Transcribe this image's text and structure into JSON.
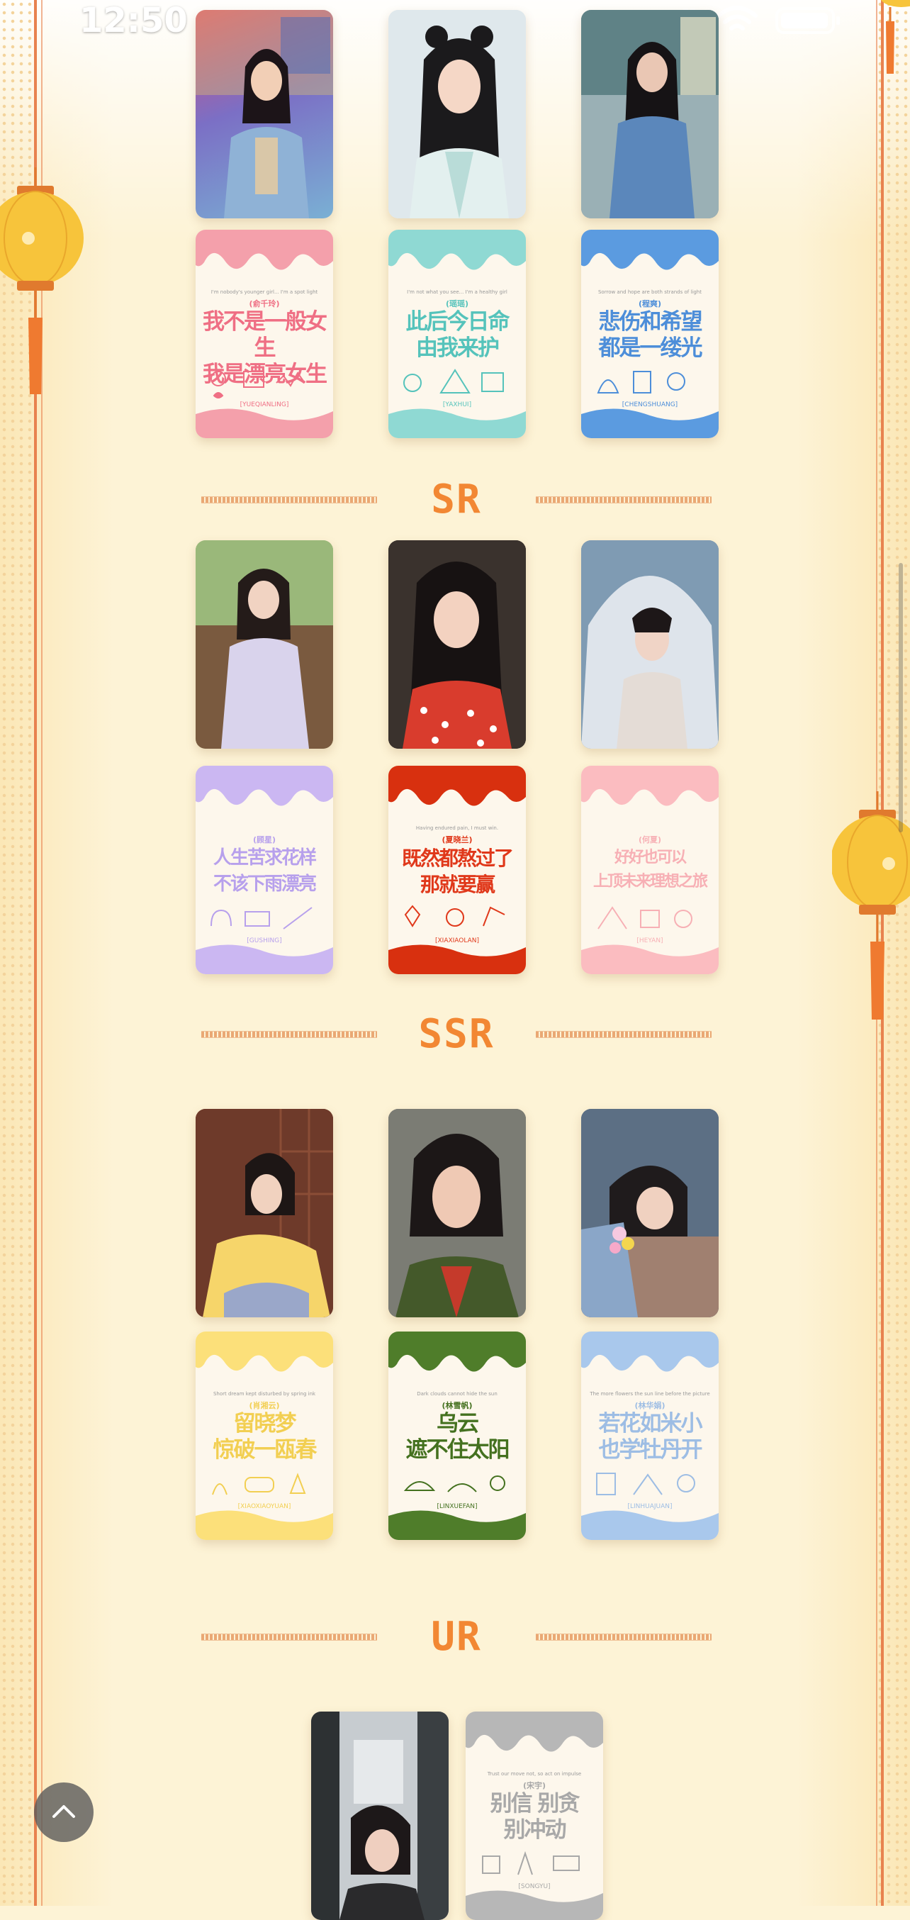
{
  "status_bar": {
    "time": "12:50"
  },
  "sections": [
    {
      "title": "SR"
    },
    {
      "title": "SSR"
    },
    {
      "title": "UR"
    }
  ],
  "text_cards": [
    {
      "en": "I'm nobody's younger girl... I'm a spot light",
      "cn_name": "(俞千玲)",
      "quote_1": "我不是一般女生",
      "quote_2": "我是漂亮女生",
      "pinyin": "[YUEQIANLING]",
      "color": "#f4a0ab",
      "text_color": "#ef6f84"
    },
    {
      "en": "I'm not what you see... I'm a healthy girl",
      "cn_name": "(瑶瑶)",
      "quote_1": "此后今日命",
      "quote_2": "由我来护",
      "pinyin": "[YAXHUI]",
      "color": "#8fd9d3",
      "text_color": "#55c3bb"
    },
    {
      "en": "Sorrow and hope are both strands of light",
      "cn_name": "(程爽)",
      "quote_1": "悲伤和希望",
      "quote_2": "都是一缕光",
      "pinyin": "[CHENGSHUANG]",
      "color": "#5b9be0",
      "text_color": "#4d8ed9"
    },
    {
      "en": "",
      "cn_name": "(顾星)",
      "quote_1": "人生苦求花样",
      "quote_2": "不该下雨漂亮",
      "pinyin": "[GUSHING]",
      "color": "#cbb7f2",
      "text_color": "#b7a0ec"
    },
    {
      "en": "Having endured pain, I must win.",
      "cn_name": "(夏晓兰)",
      "quote_1": "既然都熬过了",
      "quote_2": "那就要赢",
      "pinyin": "[XIAXIAOLAN]",
      "color": "#d8300f",
      "text_color": "#e0381a"
    },
    {
      "en": "",
      "cn_name": "(何夏)",
      "quote_1": "好好也可以",
      "quote_2": "上顶未来理想之旅",
      "pinyin": "[HEYAN]",
      "color": "#fbbcc0",
      "text_color": "#f7b0b5"
    },
    {
      "en": "Short dream kept disturbed by spring ink",
      "cn_name": "(肖湘云)",
      "quote_1": "留晓梦",
      "quote_2": "惊破一瓯春",
      "pinyin": "[XIAOXIAOYUAN]",
      "color": "#fce07a",
      "text_color": "#f2cf52"
    },
    {
      "en": "Dark clouds cannot hide the sun",
      "cn_name": "(林雪帆)",
      "quote_1": "乌云",
      "quote_2": "遮不住太阳",
      "pinyin": "[LINXUEFAN]",
      "color": "#4f7d2a",
      "text_color": "#44711f"
    },
    {
      "en": "The more flowers the sun line before the picture",
      "cn_name": "(林华娟)",
      "quote_1": "若花如米小",
      "quote_2": "也学牡丹开",
      "pinyin": "[LINHUAJUAN]",
      "color": "#a9c8ec",
      "text_color": "#9dbde4"
    },
    {
      "en": "Trust our move not, so act on impulse",
      "cn_name": "(宋宇)",
      "quote_1": "别信 别贪",
      "quote_2": "别冲动",
      "pinyin": "[SONGYU]",
      "color": "#b7b7b7",
      "text_color": "#a8a8a8"
    }
  ],
  "icons": [
    "paw-icon",
    "signal-icon",
    "wifi-icon",
    "battery-icon",
    "lantern-icon",
    "chevron-up-icon"
  ]
}
